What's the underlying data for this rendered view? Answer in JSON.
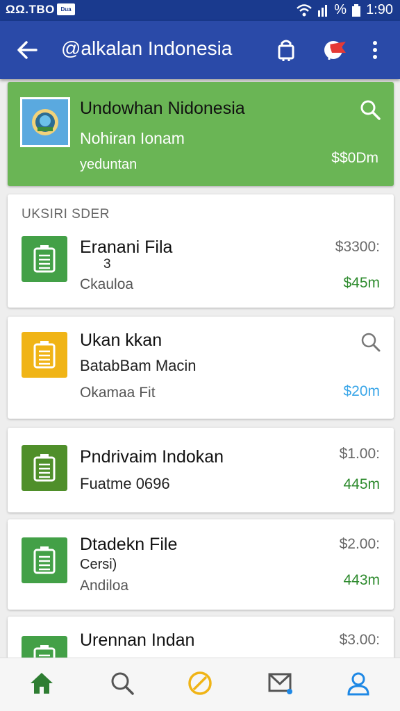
{
  "status_bar": {
    "carrier": "ΩΩ.TBO",
    "chip": "Dua",
    "battery_text": "%",
    "time": "1:90"
  },
  "header": {
    "title": "@alkalan Indonesia",
    "back_icon": "arrow-left-icon",
    "bag_icon": "bag-icon",
    "flag_icon": "flag-icon",
    "menu_icon": "more-vert-icon"
  },
  "featured": {
    "title": "Undowhan Nidonesia",
    "subtitle": "Nohiran Ionam",
    "caption": "yeduntan",
    "price": "$$0Dm",
    "search_icon": "search-icon"
  },
  "section": {
    "header": "UKSIRI SDER"
  },
  "items": [
    {
      "name": "Eranani Fila",
      "line2": "3",
      "meta": "Ckauloa",
      "price": "$3300:",
      "amount": "$45m",
      "icon_color": "#43a047",
      "amount_color": "#2e8b2e"
    },
    {
      "name": "Ukan kkan",
      "line2": "BatabBam Macin",
      "meta": "Okamaa Fit",
      "price": "",
      "amount": "$20m",
      "icon_color": "#f0b416",
      "amount_color": "#3aa6e8"
    },
    {
      "name": "Pndrivaim Indokan",
      "line2": "Fuatme 0696",
      "meta": "",
      "price": "$1.00:",
      "amount": "445m",
      "icon_color": "#4f8f2a",
      "amount_color": "#2e8b2e"
    },
    {
      "name": "Dtadekn File",
      "line2": "Cersi)",
      "meta": "Andiloa",
      "price": "$2.00:",
      "amount": "443m",
      "icon_color": "#43a047",
      "amount_color": "#2e8b2e"
    },
    {
      "name": "Urennan Indan",
      "line2": "",
      "meta": "",
      "price": "$3.00:",
      "amount": "",
      "icon_color": "#43a047",
      "amount_color": "#2e8b2e"
    }
  ],
  "bottom_nav": [
    {
      "icon": "home-icon",
      "color": "#2e7d32"
    },
    {
      "icon": "search-icon",
      "color": "#555555"
    },
    {
      "icon": "blocked-icon",
      "color": "#f0b416"
    },
    {
      "icon": "mail-icon",
      "color": "#555555"
    },
    {
      "icon": "profile-icon",
      "color": "#1e88e5"
    }
  ]
}
